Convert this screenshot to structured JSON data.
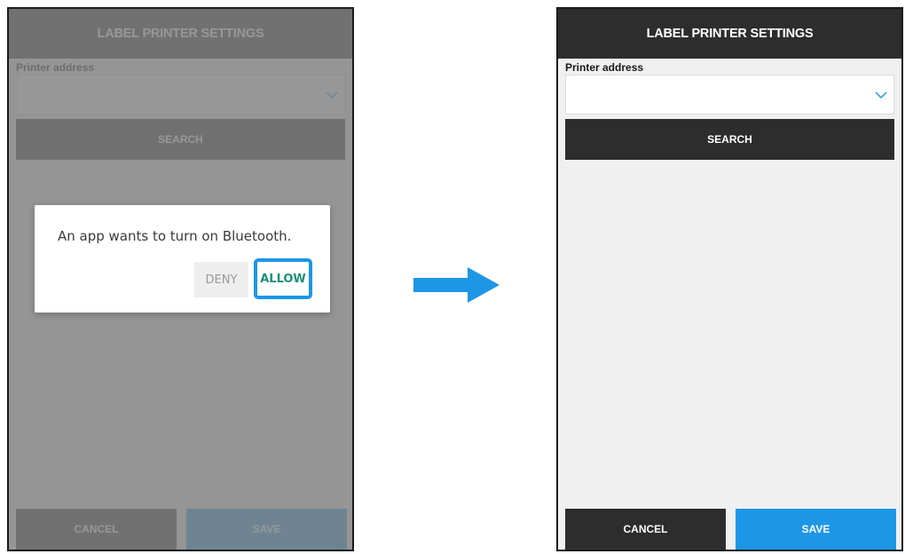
{
  "screen": {
    "title": "LABEL PRINTER SETTINGS",
    "printer_address_label": "Printer address",
    "printer_address_value": "",
    "search_label": "SEARCH",
    "cancel_label": "CANCEL",
    "save_label": "SAVE"
  },
  "dialog": {
    "message": "An app wants to turn on Bluetooth.",
    "deny_label": "DENY",
    "allow_label": "ALLOW"
  },
  "icons": {
    "dropdown": "chevron-down-icon",
    "transition": "arrow-right-icon"
  },
  "colors": {
    "header_bg": "#2d2d2d",
    "save_bg": "#1e96e6",
    "allow_text": "#1a8f7a",
    "highlight": "#1e96e6",
    "arrow": "#1e96e6"
  }
}
